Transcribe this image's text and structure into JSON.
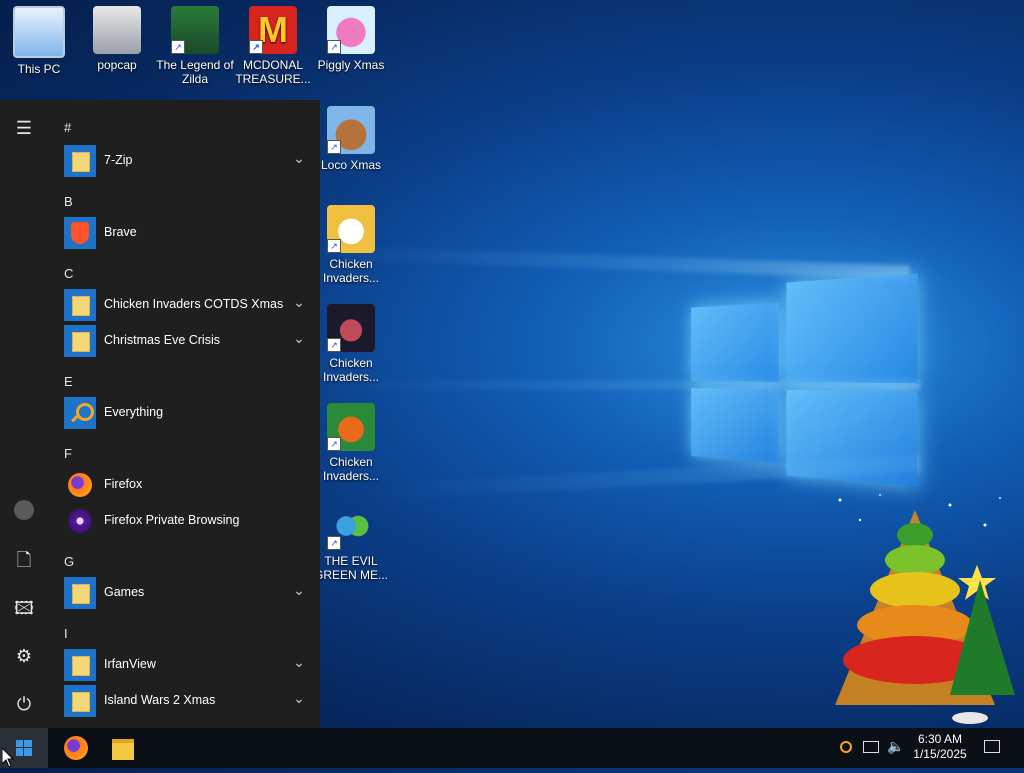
{
  "desktop": {
    "icons": [
      {
        "label": "This PC"
      },
      {
        "label": "popcap"
      },
      {
        "label": "The Legend of Zilda"
      },
      {
        "label": "MCDONAL TREASURE..."
      },
      {
        "label": "Piggly Xmas"
      },
      {
        "label": "Loco Xmas"
      },
      {
        "label": "Chicken Invaders..."
      },
      {
        "label": "Chicken Invaders..."
      },
      {
        "label": "Chicken Invaders..."
      },
      {
        "label": "THE EVIL GREEN ME..."
      }
    ]
  },
  "start_menu": {
    "sections": [
      {
        "letter": "#"
      },
      {
        "letter": "B"
      },
      {
        "letter": "C"
      },
      {
        "letter": "E"
      },
      {
        "letter": "F"
      },
      {
        "letter": "G"
      },
      {
        "letter": "I"
      }
    ],
    "apps": [
      {
        "label": "7-Zip",
        "icon": "folder-icon"
      },
      {
        "label": "Brave",
        "icon": "brave-icon"
      },
      {
        "label": "Chicken Invaders COTDS Xmas",
        "icon": "folder-icon"
      },
      {
        "label": "Christmas Eve Crisis",
        "icon": "folder-icon"
      },
      {
        "label": "Everything",
        "icon": "search-icon"
      },
      {
        "label": "Firefox",
        "icon": "firefox-icon"
      },
      {
        "label": "Firefox Private Browsing",
        "icon": "firefox-private-icon"
      },
      {
        "label": "Games",
        "icon": "folder-icon"
      },
      {
        "label": "IrfanView",
        "icon": "folder-icon"
      },
      {
        "label": "Island Wars 2 Xmas",
        "icon": "folder-icon"
      }
    ],
    "rail": [
      "hamburger-icon",
      "user-icon",
      "documents-icon",
      "pictures-icon",
      "settings-icon",
      "power-icon"
    ]
  },
  "taskbar": {
    "pinned": [
      "start-icon",
      "firefox-icon",
      "file-explorer-icon"
    ],
    "tray_icons": [
      "everything-search-icon",
      "network-icon",
      "volume-icon"
    ],
    "clock": {
      "time": "6:30 AM",
      "date": "1/15/2025"
    },
    "notification_icon": "action-center-icon"
  },
  "colors": {
    "accent": "#1e72c8",
    "menu_bg": "#1f1f1f",
    "taskbar_bg": "#0b0f16"
  }
}
